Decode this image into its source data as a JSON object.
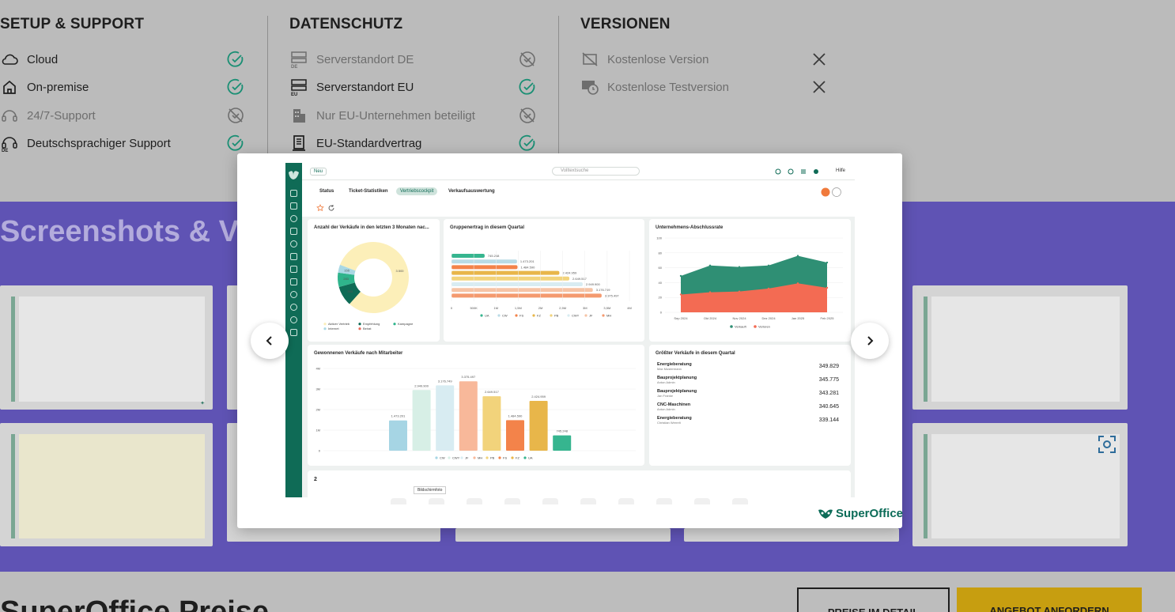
{
  "features": {
    "setup": {
      "title": "SETUP & SUPPORT",
      "items": [
        {
          "label": "Cloud",
          "icon": "cloud-icon",
          "status": "check",
          "dim": false
        },
        {
          "label": "On-premise",
          "icon": "house-icon",
          "status": "check",
          "dim": false
        },
        {
          "label": "24/7-Support",
          "icon": "headset-icon",
          "status": "no",
          "dim": true
        },
        {
          "label": "Deutschsprachiger Support",
          "icon": "headset-de-icon",
          "status": "check",
          "dim": false
        }
      ]
    },
    "privacy": {
      "title": "DATENSCHUTZ",
      "items": [
        {
          "label": "Serverstandort DE",
          "icon": "server-de-icon",
          "status": "no",
          "dim": true
        },
        {
          "label": "Serverstandort EU",
          "icon": "server-eu-icon",
          "status": "check",
          "dim": false
        },
        {
          "label": "Nur EU-Unternehmen beteiligt",
          "icon": "building-icon",
          "status": "no",
          "dim": true
        },
        {
          "label": "EU-Standardvertrag",
          "icon": "contract-icon",
          "status": "check",
          "dim": false
        }
      ]
    },
    "versions": {
      "title": "VERSIONEN",
      "items": [
        {
          "label": "Kostenlose Version",
          "icon": "free-version-icon",
          "status": "x",
          "dim": true
        },
        {
          "label": "Kostenlose Testversion",
          "icon": "trial-icon",
          "status": "x",
          "dim": true
        }
      ]
    }
  },
  "screenshots_heading": "Screenshots & Vi",
  "prices_heading": "SuperOffice Preise",
  "buttons": {
    "prices": "PREISE IM DETAIL",
    "offer": "ANGEBOT ANFORDERN"
  },
  "lightbox": {
    "logo_text": "SuperOffice",
    "app": {
      "new_label": "Neu",
      "search_placeholder": "Volltextsuche",
      "help": "Hilfe",
      "tabs": [
        "Status",
        "Ticket-Statistiken",
        "Vertriebscockpit",
        "Verkaufsauswertung"
      ],
      "bottom_number": "2",
      "tooltip": "Bildschirmfoto"
    }
  },
  "chart_data": [
    {
      "type": "pie",
      "title": "Anzahl der Verkäufe in den letzten 3 Monaten nac...",
      "labels": [
        "Aktiver Vertrieb",
        "Empfehlung",
        "Kampagne",
        "Internet",
        "Beirat"
      ],
      "values": [
        3500,
        393,
        283,
        155,
        0
      ],
      "value_labels": [
        "3.500",
        "393",
        "283",
        "155",
        ""
      ],
      "colors": [
        "#fcefb9",
        "#0f6b56",
        "#2fb48c",
        "#a9d8e4",
        "#e86a5a"
      ],
      "legend": "bottom"
    },
    {
      "type": "bar",
      "orientation": "horizontal",
      "title": "Gruppenertrag in diesem Quartal",
      "categories": [
        "UA",
        "CW",
        "FS",
        "FZ",
        "PB",
        "CWY",
        "JF",
        "MH"
      ],
      "values": [
        745248,
        1473201,
        1484590,
        2424959,
        2649517,
        2949900,
        3176749,
        3375497
      ],
      "value_labels": [
        "745.248",
        "1.473.201",
        "1.484.590",
        "2.424.959",
        "2.649.517",
        "2.949.900",
        "3.176.749",
        "3.375.497"
      ],
      "colors": [
        "#36b58f",
        "#b9dbe6",
        "#f3834a",
        "#e8b64a",
        "#f2d37b",
        "#d8ecf2",
        "#f6c3a5",
        "#f49a6f"
      ],
      "xticks": [
        "0",
        "500K",
        "1M",
        "1,5M",
        "2M",
        "2,5M",
        "3M",
        "3,5M",
        "4M"
      ],
      "xlim": [
        0,
        4000000
      ],
      "legend": "bottom"
    },
    {
      "type": "area",
      "title": "Unternehmens-Abschlussrate",
      "x": [
        "Sep 2024",
        "Okt 2024",
        "Nov 2024",
        "Dez 2024",
        "Jan 2025",
        "Feb 2025"
      ],
      "series": [
        {
          "name": "Verkauft",
          "values": [
            49,
            63,
            61,
            63,
            76,
            67
          ],
          "color": "#2f8f74"
        },
        {
          "name": "Verloren",
          "values": [
            24,
            27,
            28,
            32,
            39,
            33
          ],
          "color": "#f36b53"
        }
      ],
      "ylim": [
        0,
        100
      ],
      "yticks": [
        "0",
        "20",
        "40",
        "60",
        "80",
        "100"
      ],
      "legend": "bottom"
    },
    {
      "type": "bar",
      "title": "Gewonnenen Verkäufe nach Mitarbeiter",
      "categories": [
        "CW",
        "CWY",
        "JF",
        "MH",
        "PB",
        "FS",
        "FZ",
        "UA"
      ],
      "values": [
        1473201,
        2949900,
        3176749,
        3375497,
        2649517,
        1484590,
        2424959,
        745248
      ],
      "value_labels": [
        "1.473.201",
        "2.949.900",
        "3.176.749",
        "3.375.497",
        "2.649.517",
        "1.484.590",
        "2.424.959",
        "745.248"
      ],
      "colors": [
        "#a6d5e4",
        "#d7efe6",
        "#d8ecf2",
        "#f8b89a",
        "#f2d37b",
        "#f3834a",
        "#e8b64a",
        "#36b58f"
      ],
      "yticks": [
        "0",
        "1M",
        "2M",
        "3M",
        "4M"
      ],
      "ylim": [
        0,
        4000000
      ],
      "legend": "bottom"
    },
    {
      "type": "table",
      "title": "Größter Verkäufe in diesem Quartal",
      "rows": [
        {
          "name": "Energieberatung",
          "person": "Max Mustermann",
          "value": "349.829"
        },
        {
          "name": "Bauprojektplanung",
          "person": "Anton Admin",
          "value": "345.775"
        },
        {
          "name": "Bauprojektplanung",
          "person": "Jan Franke",
          "value": "343.281"
        },
        {
          "name": "CNC-Maschinen",
          "person": "Anton Admin",
          "value": "340.645"
        },
        {
          "name": "Energieberatung",
          "person": "Christian Werrelt",
          "value": "339.144"
        }
      ]
    }
  ]
}
